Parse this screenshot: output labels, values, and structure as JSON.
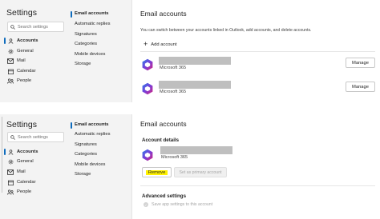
{
  "top": {
    "nav": {
      "title": "Settings",
      "search_placeholder": "Search settings",
      "items": [
        {
          "label": "Accounts",
          "icon": "person-icon"
        },
        {
          "label": "General",
          "icon": "gear-icon"
        },
        {
          "label": "Mail",
          "icon": "mail-icon"
        },
        {
          "label": "Calendar",
          "icon": "calendar-icon"
        },
        {
          "label": "People",
          "icon": "people-icon"
        }
      ]
    },
    "sub": {
      "items": [
        "Email accounts",
        "Automatic replies",
        "Signatures",
        "Categories",
        "Mobile devices",
        "Storage"
      ]
    },
    "main": {
      "heading": "Email accounts",
      "description": "You can switch between your accounts linked in Outlook, add accounts, and delete accounts.",
      "add_label": "Add account",
      "accounts": [
        {
          "type": "Microsoft 365",
          "manage_label": "Manage"
        },
        {
          "type": "Microsoft 365",
          "manage_label": "Manage"
        }
      ]
    }
  },
  "bottom": {
    "nav": {
      "title": "Settings",
      "search_placeholder": "Search settings",
      "items": [
        {
          "label": "Accounts",
          "icon": "person-icon"
        },
        {
          "label": "General",
          "icon": "gear-icon"
        },
        {
          "label": "Mail",
          "icon": "mail-icon"
        },
        {
          "label": "Calendar",
          "icon": "calendar-icon"
        },
        {
          "label": "People",
          "icon": "people-icon"
        }
      ]
    },
    "sub": {
      "items": [
        "Email accounts",
        "Automatic replies",
        "Signatures",
        "Categories",
        "Mobile devices",
        "Storage"
      ]
    },
    "main": {
      "heading": "Email accounts",
      "account_details": "Account details",
      "account_type": "Microsoft 365",
      "remove_label": "Remove",
      "primary_label": "Set as primary account",
      "advanced": "Advanced settings",
      "save_app_settings": "Save app settings to this account"
    }
  },
  "colors": {
    "accent": "#0f6cbd",
    "highlight": "#fff100",
    "redaction": "#bfbfbf",
    "nav_bg": "#f3f3f3"
  }
}
